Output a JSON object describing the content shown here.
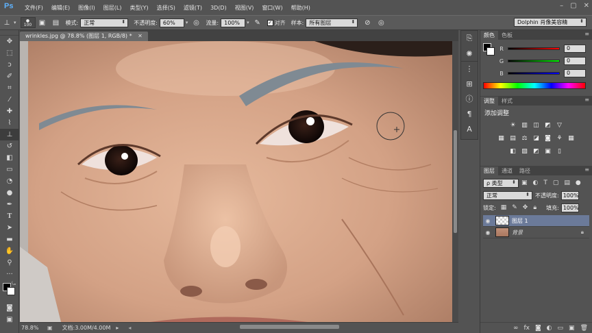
{
  "app": {
    "logo": "Ps"
  },
  "menu": [
    "文件(F)",
    "编辑(E)",
    "图像(I)",
    "图层(L)",
    "类型(Y)",
    "选择(S)",
    "滤镜(T)",
    "3D(D)",
    "视图(V)",
    "窗口(W)",
    "帮助(H)"
  ],
  "window_controls": {
    "minimize": "–",
    "maximize": "▢",
    "close": "✕"
  },
  "options": {
    "brush_size": "100",
    "mode_label": "模式:",
    "mode_value": "正常",
    "opacity_label": "不透明度:",
    "opacity_value": "60%",
    "flow_label": "流量:",
    "flow_value": "100%",
    "align_label": "对齐",
    "sample_label": "样本:",
    "sample_value": "所有图层",
    "workspace": "Dolphin 肖像美容精"
  },
  "document": {
    "tab_title": "wrinkles.jpg @ 78.8% (图层 1, RGB/8) *",
    "zoom": "78.8%",
    "doc_info": "文档:3.00M/4.00M"
  },
  "color_panel": {
    "tabs": [
      "颜色",
      "色板"
    ],
    "channels": [
      {
        "label": "R",
        "value": "0"
      },
      {
        "label": "G",
        "value": "0"
      },
      {
        "label": "B",
        "value": "0"
      }
    ]
  },
  "adjust_panel": {
    "tabs": [
      "调整",
      "样式"
    ],
    "title": "添加调整"
  },
  "layers_panel": {
    "tabs": [
      "图层",
      "通道",
      "路径"
    ],
    "filter_label": "ρ 类型",
    "blend_mode": "正常",
    "opacity_label": "不透明度:",
    "opacity_value": "100%",
    "lock_label": "锁定:",
    "fill_label": "填充:",
    "fill_value": "100%",
    "layers": [
      {
        "name": "图层 1",
        "selected": true
      },
      {
        "name": "背景",
        "selected": false
      }
    ]
  },
  "colors": {
    "accent": "#5fb3ff",
    "selected_layer": "#6b7a99",
    "canvas_skin": "#c99d84"
  }
}
